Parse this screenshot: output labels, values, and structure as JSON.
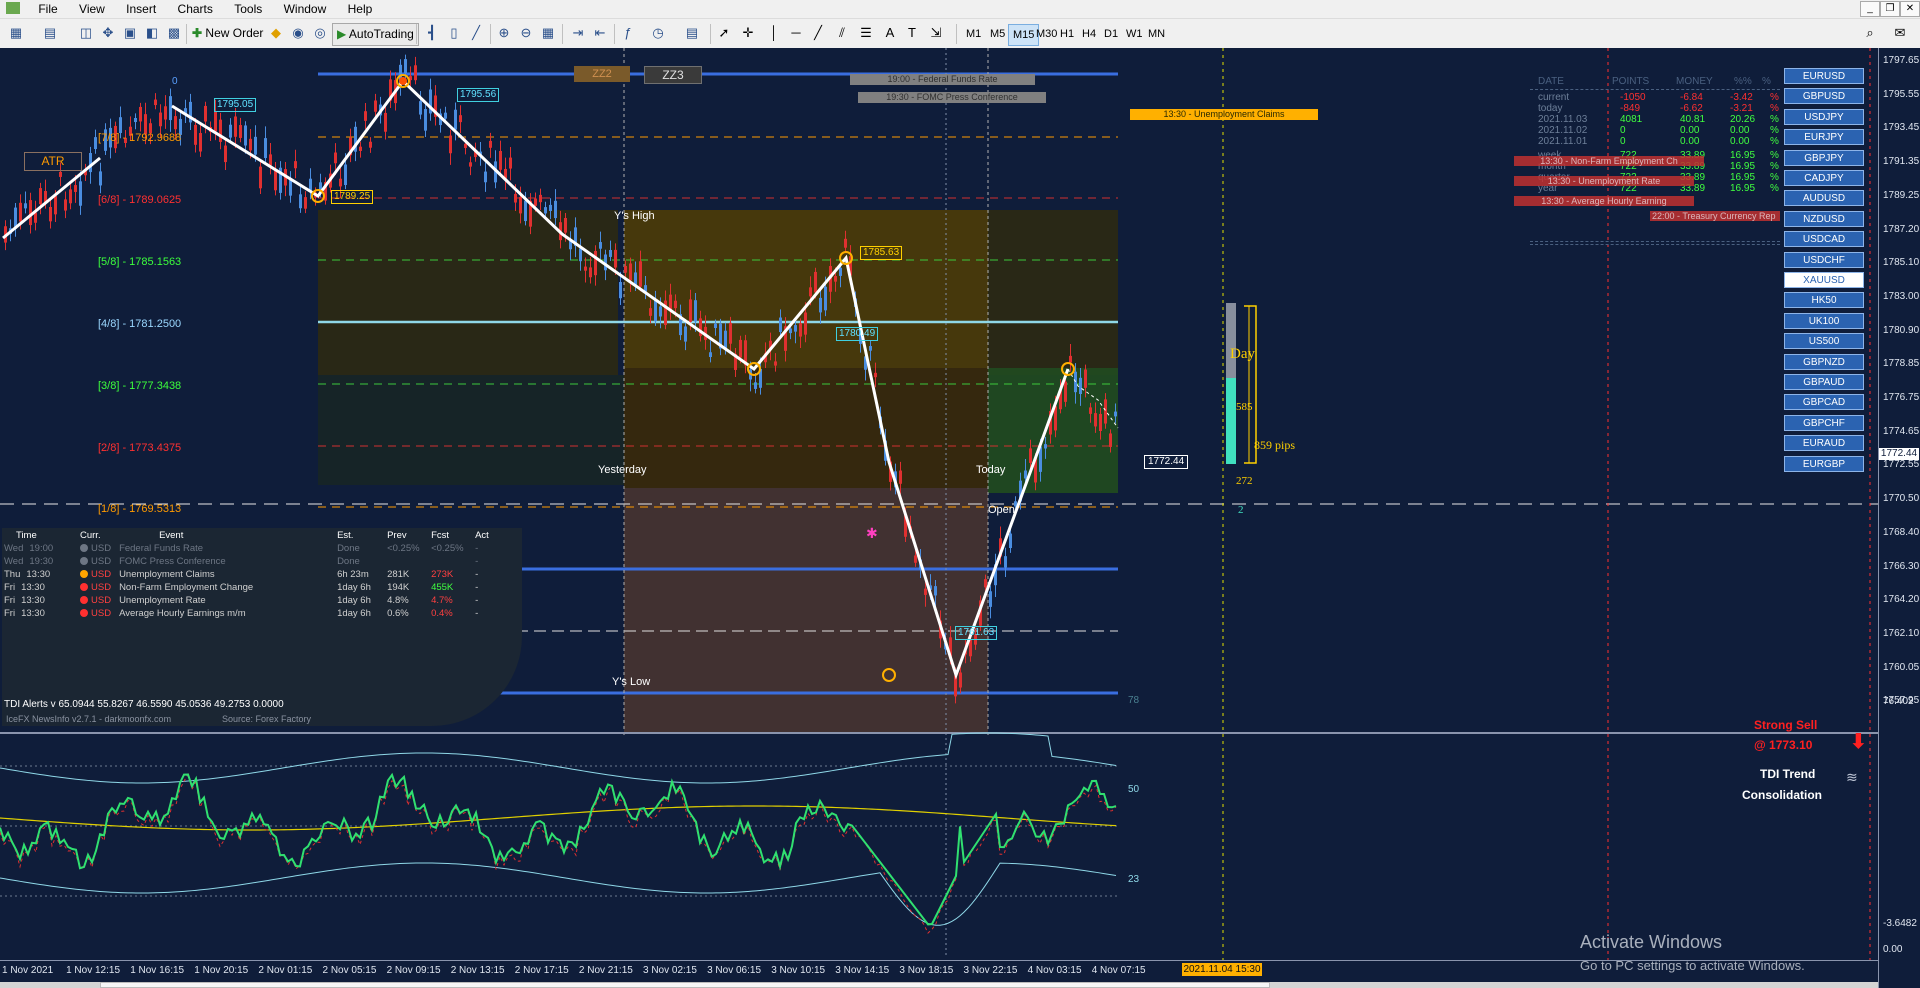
{
  "menu": {
    "items": [
      "File",
      "View",
      "Insert",
      "Charts",
      "Tools",
      "Window",
      "Help"
    ]
  },
  "toolbar": {
    "new_order": "New Order",
    "autotrading": "AutoTrading",
    "timeframes": [
      "M1",
      "M5",
      "M15",
      "M30",
      "H1",
      "H4",
      "D1",
      "W1",
      "MN"
    ],
    "active_timeframe": "M15"
  },
  "chart": {
    "zz_buttons": [
      "ZZ2",
      "ZZ3"
    ],
    "atr_label": "ATR",
    "murrey": [
      {
        "label": "[7/8] - 1792.9688",
        "color": "#ff9b00"
      },
      {
        "label": "[6/8] - 1789.0625",
        "color": "#ff3030"
      },
      {
        "label": "[5/8] - 1785.1563",
        "color": "#3cff3c"
      },
      {
        "label": "[4/8] - 1781.2500",
        "color": "#9ad7ff"
      },
      {
        "label": "[3/8] - 1777.3438",
        "color": "#3cff3c"
      },
      {
        "label": "[2/8] - 1773.4375",
        "color": "#ff3030"
      },
      {
        "label": "[1/8] - 1769.5313",
        "color": "#ff9b00"
      }
    ],
    "zigzag_labels": [
      "1795.05",
      "1795.56",
      "1789.25",
      "1785.63",
      "1780.49",
      "1761.63"
    ],
    "current_price_tag": "1772.44",
    "price_axis_current": "1772.44",
    "zero_label": "0",
    "news_banners": [
      "19:00 - Federal Funds Rate",
      "19:30 - FOMC Press Conference"
    ],
    "claims_banner": "13:30 - Unemployment Claims",
    "yesterday": "Yesterday",
    "today": "Today",
    "ys_high": "Y's High",
    "ys_low": "Y's Low",
    "open": "Open",
    "day_box": {
      "title": "Day",
      "upper": "585",
      "lower": "272",
      "pips": "859 pips",
      "bottom": "2"
    },
    "price_ticks": [
      "1797.65",
      "1795.55",
      "1793.45",
      "1791.35",
      "1789.25",
      "1787.20",
      "1785.10",
      "1783.00",
      "1780.90",
      "1778.85",
      "1776.75",
      "1774.65",
      "1772.55",
      "1770.50",
      "1768.40",
      "1766.30",
      "1764.20",
      "1762.10",
      "1760.05",
      "1757.95"
    ],
    "time_ticks": [
      "1 Nov 2021",
      "1 Nov 12:15",
      "1 Nov 16:15",
      "1 Nov 20:15",
      "2 Nov 01:15",
      "2 Nov 05:15",
      "2 Nov 09:15",
      "2 Nov 13:15",
      "2 Nov 17:15",
      "2 Nov 21:15",
      "3 Nov 02:15",
      "3 Nov 06:15",
      "3 Nov 10:15",
      "3 Nov 14:15",
      "3 Nov 18:15",
      "3 Nov 22:15",
      "4 Nov 03:15",
      "4 Nov 07:15"
    ],
    "time_marker": "2021.11.04 15:30"
  },
  "news": {
    "headers": [
      "Time",
      "Curr.",
      "Event",
      "Est.",
      "Prev",
      "Fcst",
      "Act"
    ],
    "rows": [
      {
        "day": "Wed",
        "time": "19:00",
        "cur": "USD",
        "event": "Federal Funds Rate",
        "est": "Done",
        "prev": "<0.25%",
        "fcst": "<0.25%",
        "act": "-",
        "dim": true,
        "dot": "#6d7684",
        "fcol": "#6d7684"
      },
      {
        "day": "Wed",
        "time": "19:30",
        "cur": "USD",
        "event": "FOMC Press Conference",
        "est": "Done",
        "prev": "",
        "fcst": "",
        "act": "-",
        "dim": true,
        "dot": "#6d7684",
        "fcol": "#6d7684"
      },
      {
        "day": "Thu",
        "time": "13:30",
        "cur": "USD",
        "event": "Unemployment Claims",
        "est": "6h 23m",
        "prev": "281K",
        "fcst": "273K",
        "act": "-",
        "dim": false,
        "dot": "#ffa500",
        "fcol": "#ff4040"
      },
      {
        "day": "Fri",
        "time": "13:30",
        "cur": "USD",
        "event": "Non-Farm Employment Change",
        "est": "1day 6h",
        "prev": "194K",
        "fcst": "455K",
        "act": "-",
        "dim": false,
        "dot": "#ff3030",
        "fcol": "#40ff40"
      },
      {
        "day": "Fri",
        "time": "13:30",
        "cur": "USD",
        "event": "Unemployment Rate",
        "est": "1day 6h",
        "prev": "4.8%",
        "fcst": "4.7%",
        "act": "-",
        "dim": false,
        "dot": "#ff3030",
        "fcol": "#ff4040"
      },
      {
        "day": "Fri",
        "time": "13:30",
        "cur": "USD",
        "event": "Average Hourly Earnings m/m",
        "est": "1day 6h",
        "prev": "0.6%",
        "fcst": "0.4%",
        "act": "-",
        "dim": false,
        "dot": "#ff3030",
        "fcol": "#ff4040"
      }
    ],
    "footer_left": "IceFX NewsInfo v2.7.1 - darkmoonfx.com",
    "footer_right": "Source: Forex Factory"
  },
  "stats": {
    "headers": [
      "DATE",
      "POINTS",
      "MONEY",
      "%%",
      "%"
    ],
    "rows": [
      {
        "label": "current",
        "points": "-1050",
        "money": "-6.84",
        "p1": "-3.42",
        "p2": "%",
        "col": "#ff3030"
      },
      {
        "label": "today",
        "points": "-849",
        "money": "-6.62",
        "p1": "-3.21",
        "p2": "%",
        "col": "#ff3030"
      },
      {
        "label": "2021.11.03",
        "points": "4081",
        "money": "40.81",
        "p1": "20.26",
        "p2": "%",
        "col": "#40ff40"
      },
      {
        "label": "2021.11.02",
        "points": "0",
        "money": "0.00",
        "p1": "0.00",
        "p2": "%",
        "col": "#40ff40"
      },
      {
        "label": "2021.11.01",
        "points": "0",
        "money": "0.00",
        "p1": "0.00",
        "p2": "%",
        "col": "#40ff40"
      },
      {
        "label": "week",
        "points": "722",
        "money": "33.89",
        "p1": "16.95",
        "p2": "%",
        "col": "#40ff40"
      },
      {
        "label": "month",
        "points": "722",
        "money": "33.89",
        "p1": "16.95",
        "p2": "%",
        "col": "#40ff40"
      },
      {
        "label": "quarter",
        "points": "722",
        "money": "33.89",
        "p1": "16.95",
        "p2": "%",
        "col": "#40ff40"
      },
      {
        "label": "year",
        "points": "722",
        "money": "33.89",
        "p1": "16.95",
        "p2": "%",
        "col": "#40ff40"
      }
    ],
    "news_overlays": [
      "13:30 - Non-Farm Employment Ch",
      "13:30 - Unemployment Rate",
      "13:30 - Average Hourly Earning",
      "22:00 - Treasury Currency Rep"
    ]
  },
  "symbols": [
    "EURUSD",
    "GBPUSD",
    "USDJPY",
    "EURJPY",
    "GBPJPY",
    "CADJPY",
    "AUDUSD",
    "NZDUSD",
    "USDCAD",
    "USDCHF",
    "XAUUSD",
    "HK50",
    "UK100",
    "US500",
    "GBPNZD",
    "GBPAUD",
    "GBPCAD",
    "GBPCHF",
    "EURAUD",
    "EURGBP"
  ],
  "selected_symbol": "XAUUSD",
  "tdi": {
    "header": "TDI Alerts v 65.0944 55.8267 46.5590 45.0536 49.2753 0.0000",
    "levels": [
      "78",
      "50",
      "23"
    ],
    "scale_top": "76.402",
    "scale_bottom": "-3.6482",
    "scale_zero": "0.00",
    "signal": "Strong Sell",
    "signal_price": "@ 1773.10",
    "trend_title": "TDI Trend",
    "trend_value": "Consolidation"
  },
  "watermark": {
    "title": "Activate Windows",
    "subtitle": "Go to PC settings to activate Windows."
  }
}
